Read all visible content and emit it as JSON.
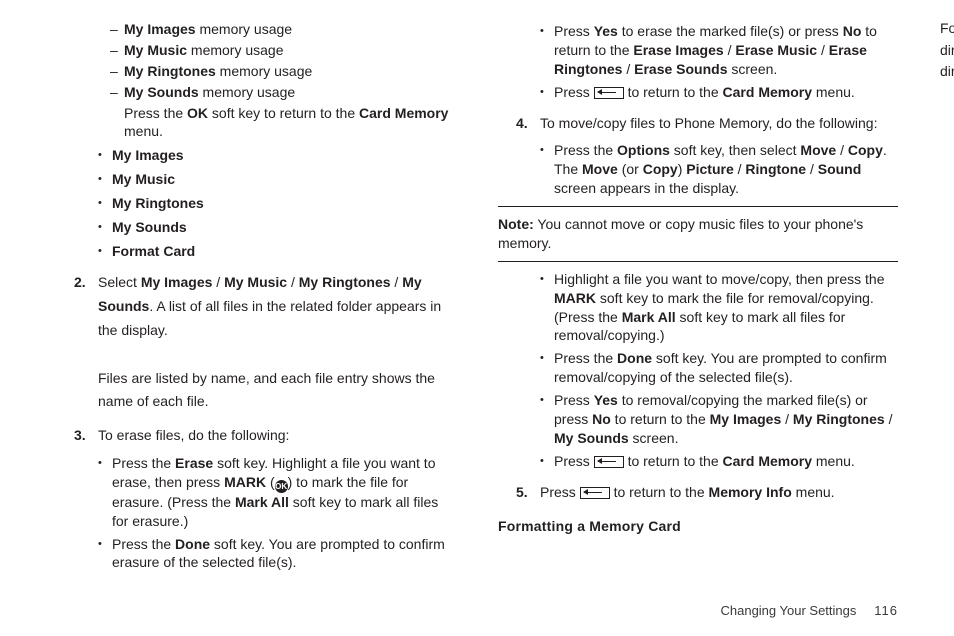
{
  "col_left": {
    "dash_items": [
      {
        "bold": "My Images",
        "rest": " memory usage"
      },
      {
        "bold": "My Music",
        "rest": " memory usage"
      },
      {
        "bold": "My Ringtones",
        "rest": " memory usage"
      },
      {
        "bold": "My Sounds",
        "rest": " memory usage"
      }
    ],
    "dash_tail_pre": "Press the ",
    "dash_tail_b1": "OK",
    "dash_tail_mid": " soft key to return to the ",
    "dash_tail_b2": "Card Memory",
    "dash_tail_post": " menu.",
    "bullet_items": [
      "My Images",
      "My Music",
      "My Ringtones",
      "My Sounds",
      "Format Card"
    ],
    "step2_num": "2.",
    "step2_pre": "Select ",
    "step2_join": " / ",
    "step2_b": [
      "My Images",
      "My Music",
      "My Ringtones",
      "My Sounds"
    ],
    "step2_line1_tail": ". A",
    "step2_line2": "list of all files in the related folder appears in the display.",
    "step2_p2a": "Files are listed by name, and each file entry shows the",
    "step2_p2b": "name of each file.",
    "step3_num": "3.",
    "step3_text": "To erase files, do the following:",
    "s3a_pre": "Press the ",
    "s3a_b1": "Erase",
    "s3a_mid1": " soft key. Highlight a file you want to erase, then press ",
    "s3a_b2": "MARK",
    "s3a_mid2": " (",
    "s3a_icon": "OK",
    "s3a_mid3": ") to mark the file for erasure. (Press the ",
    "s3a_b3": "Mark All",
    "s3a_tail": " soft key to mark all files for erasure.)",
    "s3b_pre": "Press the ",
    "s3b_b1": "Done",
    "s3b_tail": " soft key. You are prompted to confirm erasure of the selected file(s)."
  },
  "col_right": {
    "r3c_pre": "Press ",
    "r3c_b1": "Yes",
    "r3c_mid1": " to erase the marked file(s) or press ",
    "r3c_b2": "No",
    "r3c_mid2": " to return to the ",
    "r3c_b3": "Erase Images",
    "r3c_j": " / ",
    "r3c_b4": "Erase Music",
    "r3c_b5": "Erase Ringtones",
    "r3c_b6": "Erase Sounds",
    "r3c_tail": " screen.",
    "r3d_pre": "Press ",
    "r3d_mid": " to return to the ",
    "r3d_b": "Card Memory",
    "r3d_tail": " menu.",
    "step4_num": "4.",
    "step4_text": "To move/copy files to Phone Memory, do the following:",
    "s4a_pre": "Press the ",
    "s4a_b1": "Options",
    "s4a_mid1": " soft key, then select ",
    "s4a_b2": "Move",
    "s4a_j": " / ",
    "s4a_b3": "Copy",
    "s4a_mid2": ". The ",
    "s4a_b4": "Move",
    "s4a_mid3": " (or ",
    "s4a_b5": "Copy",
    "s4a_mid4": ") ",
    "s4a_b6": "Picture",
    "s4a_b7": "Ringtone",
    "s4a_b8": "Sound",
    "s4a_tail": " screen appears in the display.",
    "note_b": "Note:",
    "note_text": " You cannot move or copy music files to your phone's memory.",
    "s4b_pre": "Highlight a file you want to move/copy, then press the ",
    "s4b_b1": "MARK",
    "s4b_mid1": " soft key to mark the file for removal/copying. (Press the ",
    "s4b_b2": "Mark All",
    "s4b_tail": " soft key to mark all files for removal/copying.)",
    "s4c_pre": "Press the ",
    "s4c_b1": "Done",
    "s4c_tail": " soft key. You are prompted to confirm removal/copying of the selected file(s).",
    "s4d_pre": "Press ",
    "s4d_b1": "Yes",
    "s4d_mid1": " to removal/copying the marked file(s) or press ",
    "s4d_b2": "No",
    "s4d_mid2": " to return to the ",
    "s4d_b3": "My Images",
    "s4d_j": " / ",
    "s4d_b4": "My Ringtones",
    "s4d_b5": "My Sounds",
    "s4d_tail": " screen.",
    "s4e_pre": "Press ",
    "s4e_mid": " to return to the ",
    "s4e_b": "Card Memory",
    "s4e_tail": " menu.",
    "step5_num": "5.",
    "step5_pre": "Press ",
    "step5_mid": " to return to the ",
    "step5_b": "Memory Info",
    "step5_tail": " menu.",
    "h4": "Formatting a Memory Card",
    "para": "Formatting a microSD Memory Card erases any data, files, and directories currently on the card and creates multimedia directories compatible with your phone."
  },
  "footer_section": "Changing Your Settings",
  "footer_page": "116"
}
